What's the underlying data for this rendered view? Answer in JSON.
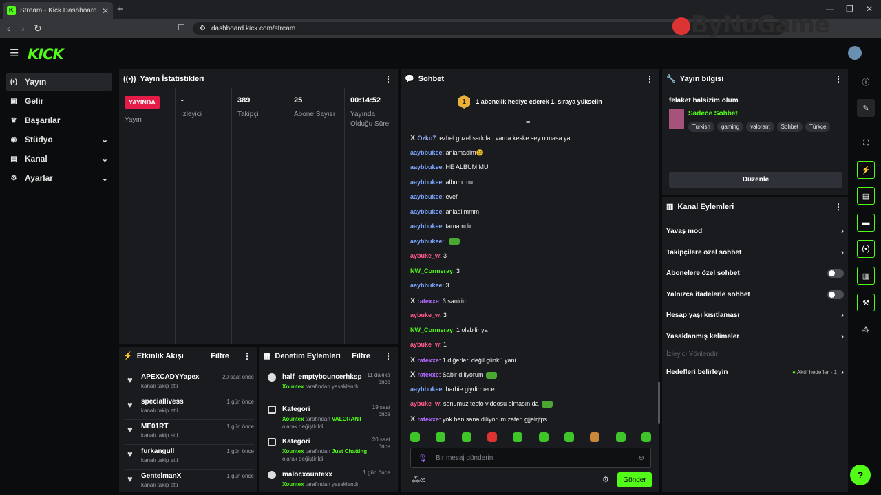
{
  "browser": {
    "tab_title": "Stream - Kick Dashboard",
    "url": "dashboard.kick.com/stream",
    "watermark": "ByNoGame"
  },
  "header": {
    "logo": "KICK"
  },
  "sidebar": {
    "items": [
      {
        "label": "Yayın",
        "icon": "broadcast-icon"
      },
      {
        "label": "Gelir",
        "icon": "revenue-icon"
      },
      {
        "label": "Başarılar",
        "icon": "trophy-icon"
      },
      {
        "label": "Stüdyo",
        "icon": "studio-icon"
      },
      {
        "label": "Kanal",
        "icon": "channel-icon"
      },
      {
        "label": "Ayarlar",
        "icon": "gear-icon"
      }
    ]
  },
  "stats": {
    "title": "Yayın İstatistikleri",
    "live_badge": "YAYINDA",
    "items": [
      {
        "value": "",
        "label": "Yayın"
      },
      {
        "value": "-",
        "label": "İzleyici"
      },
      {
        "value": "389",
        "label": "Takipçi"
      },
      {
        "value": "25",
        "label": "Abone Sayısı"
      },
      {
        "value": "00:14:52",
        "label": "Yayında Olduğu Süre"
      }
    ]
  },
  "activity": {
    "title": "Etkinlik Akışı",
    "filter": "Filtre",
    "rows": [
      {
        "name": "APEXCADYYapex",
        "sub": "kanalı takip etti",
        "time": "20 saat önce"
      },
      {
        "name": "speciallivess",
        "sub": "kanalı takip etti",
        "time": "1 gün önce"
      },
      {
        "name": "ME01RT",
        "sub": "kanalı takip etti",
        "time": "1 gün önce"
      },
      {
        "name": "furkangull",
        "sub": "kanalı takip etti",
        "time": "1 gün önce"
      },
      {
        "name": "GentelmanX",
        "sub": "kanalı takip etti",
        "time": "1 gün önce"
      }
    ]
  },
  "moderation": {
    "title": "Denetim Eylemleri",
    "filter": "Filtre",
    "rows": [
      {
        "name": "half_emptybouncerhksp",
        "actor": "Xountex",
        "text": " tarafından yasaklandı",
        "highlight": "",
        "suffix": "",
        "time": "11 dakika önce"
      },
      {
        "name": "Kategori",
        "actor": "Xountex",
        "text": " tarafından ",
        "highlight": "VALORANT",
        "suffix": " olarak değiştirildi",
        "time": "19 saat önce"
      },
      {
        "name": "Kategori",
        "actor": "Xountex",
        "text": " tarafından ",
        "highlight": "Just Chatting",
        "suffix": " olarak değiştirildi",
        "time": "20 saat önce"
      },
      {
        "name": "malocxountexx",
        "actor": "Xountex",
        "text": " tarafından yasaklandı",
        "highlight": "",
        "suffix": "",
        "time": "1 gün önce"
      }
    ]
  },
  "chat": {
    "title": "Sohbet",
    "pinned_rank": "1",
    "pinned": "1 abonelik hediye ederek 1. sıraya yükselin",
    "placeholder": "Bir mesaj gönderin",
    "send": "Gönder",
    "messages": [
      {
        "user": "Ozko7",
        "color": "#9bb3ff",
        "text": "ezhel guzel sarkilari varda keske sey olmasa ya",
        "badge": true,
        "emote": false
      },
      {
        "user": "aaybbukee",
        "color": "#7ea8ff",
        "text": "anlamadim😊",
        "badge": false,
        "emote": false
      },
      {
        "user": "aaybbukee",
        "color": "#7ea8ff",
        "text": "HE ALBUM MU",
        "badge": false,
        "emote": false
      },
      {
        "user": "aaybbukee",
        "color": "#7ea8ff",
        "text": "album mu",
        "badge": false,
        "emote": false
      },
      {
        "user": "aaybbukee",
        "color": "#7ea8ff",
        "text": "evef",
        "badge": false,
        "emote": false
      },
      {
        "user": "aaybbukee",
        "color": "#7ea8ff",
        "text": "anladiimmm",
        "badge": false,
        "emote": false
      },
      {
        "user": "aaybbukee",
        "color": "#7ea8ff",
        "text": "tamamdir",
        "badge": false,
        "emote": false
      },
      {
        "user": "aaybbukee",
        "color": "#7ea8ff",
        "text": "",
        "badge": false,
        "emote": true
      },
      {
        "user": "aybuke_w",
        "color": "#ff5c8a",
        "text": "3",
        "badge": false,
        "emote": false
      },
      {
        "user": "NW_Cormeray",
        "color": "#53fc18",
        "text": "3",
        "badge": false,
        "emote": false
      },
      {
        "user": "aaybbukee",
        "color": "#7ea8ff",
        "text": "3",
        "badge": false,
        "emote": false
      },
      {
        "user": "ratexxe",
        "color": "#b36bff",
        "text": "3 sanirim",
        "badge": true,
        "emote": false
      },
      {
        "user": "aybuke_w",
        "color": "#ff5c8a",
        "text": "3",
        "badge": false,
        "emote": false
      },
      {
        "user": "NW_Cormeray",
        "color": "#53fc18",
        "text": "1 olabilir ya",
        "badge": false,
        "emote": false
      },
      {
        "user": "aybuke_w",
        "color": "#ff5c8a",
        "text": "1",
        "badge": false,
        "emote": false
      },
      {
        "user": "ratexxe",
        "color": "#b36bff",
        "text": "1 diğerleri değil çünkü yani",
        "badge": true,
        "emote": false
      },
      {
        "user": "ratexxe",
        "color": "#b36bff",
        "text": "Sabir diliyorum",
        "badge": true,
        "emote": true
      },
      {
        "user": "aaybbukee",
        "color": "#7ea8ff",
        "text": "barbie giydirmece",
        "badge": false,
        "emote": false
      },
      {
        "user": "aybuke_w",
        "color": "#ff5c8a",
        "text": "sonumuz testo videosu olmasın da",
        "badge": false,
        "emote": true
      },
      {
        "user": "ratexxe",
        "color": "#b36bff",
        "text": "yok ben sana diliyorum zaten gjjelrjfps",
        "badge": true,
        "emote": false
      }
    ]
  },
  "stream_info": {
    "title": "Yayın bilgisi",
    "stream_title": "felaket halsizim olum",
    "category": "Sadece Sohbet",
    "tags": [
      "Turkish",
      "gaming",
      "valorant",
      "Sohbet",
      "Türkçe"
    ],
    "edit": "Düzenle"
  },
  "channel_actions": {
    "title": "Kanal Eylemleri",
    "rows": [
      {
        "label": "Yavaş mod",
        "type": "arrow"
      },
      {
        "label": "Takipçilere özel sohbet",
        "type": "arrow"
      },
      {
        "label": "Abonelere özel sohbet",
        "type": "toggle"
      },
      {
        "label": "Yalnızca ifadelerle sohbet",
        "type": "toggle"
      },
      {
        "label": "Hesap yaşı kısıtlaması",
        "type": "arrow"
      },
      {
        "label": "Yasaklanmış kelimeler",
        "type": "arrow"
      }
    ],
    "viewer_redirect": "İzleyici Yönlendir",
    "goals": "Hedefleri belirleyin",
    "goals_status": "Aktif hedefler - 1"
  },
  "colors": {
    "accent": "#53fc18",
    "live": "#e51c47",
    "panel": "#191b1f",
    "background": "#0b0c0d"
  }
}
